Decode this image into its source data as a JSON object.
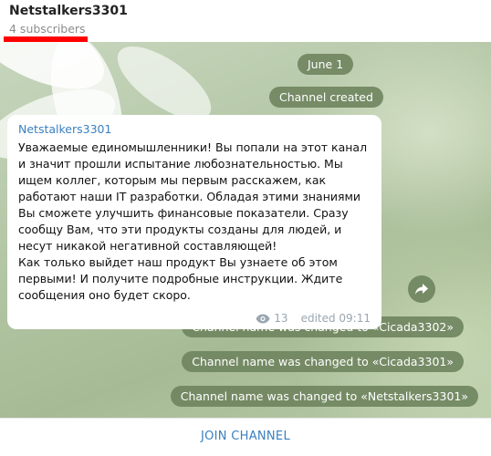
{
  "header": {
    "title": "Netstalkers3301",
    "subtitle": "4 subscribers"
  },
  "chat": {
    "date": "June 1",
    "created": "Channel created",
    "message": {
      "author": "Netstalkers3301",
      "text": "Уважаемые единомышленники! Вы попали на этот канал и значит прошли испытание любознательностью. Мы ищем коллег, которым мы первым расскажем, как работают наши IT разработки. Обладая этими знаниями Вы сможете улучшить финансовые показатели. Сразу сообщу Вам, что эти продукты созданы для людей, и несут никакой негативной составляющей!\nКак только выйдет наш продукт Вы узнаете об этом первыми! И получите подробные инструкции. Ждите сообщения оно будет скоро.",
      "views": "13",
      "edited": "edited 09:11"
    },
    "service": [
      "Channel name was changed to «Cicada3302»",
      "Channel name was changed to «Cicada3301»",
      "Channel name was changed to «Netstalkers3301»"
    ]
  },
  "footer": {
    "join_label": "JOIN CHANNEL"
  },
  "colors": {
    "accent": "#3a80c0",
    "highlight": "#ff0000",
    "pill_bg": "#708660"
  },
  "icons": {
    "views": "eye-icon",
    "share": "share-arrow-icon"
  }
}
